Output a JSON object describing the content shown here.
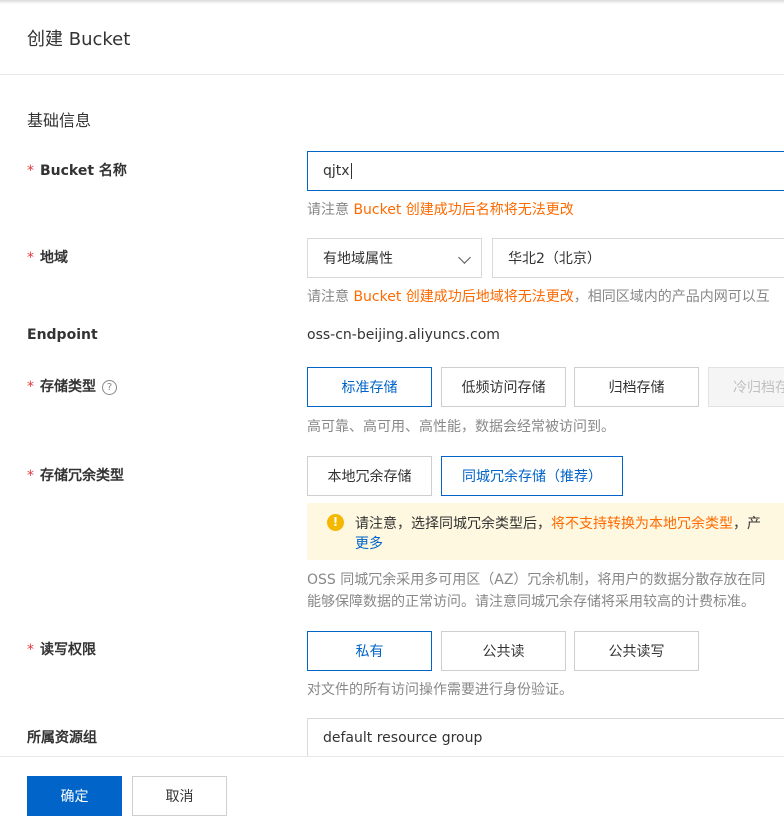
{
  "dialog": {
    "title": "创建 Bucket"
  },
  "basic": {
    "section_title": "基础信息"
  },
  "bucket_name": {
    "required_mark": "*",
    "label": "Bucket 名称",
    "value": "qjtx",
    "hint_prefix": "请注意 ",
    "hint_warn": "Bucket 创建成功后名称将无法更改"
  },
  "region": {
    "required_mark": "*",
    "label": "地域",
    "attr_select": "有地域属性",
    "region_select": "华北2（北京）",
    "hint_prefix": "请注意 ",
    "hint_warn": "Bucket 创建成功后地域将无法更改",
    "hint_suffix": "，相同区域内的产品内网可以互"
  },
  "endpoint": {
    "label": "Endpoint",
    "value": "oss-cn-beijing.aliyuncs.com"
  },
  "storage_class": {
    "required_mark": "*",
    "label": "存储类型",
    "help": "?",
    "options": [
      "标准存储",
      "低频访问存储",
      "归档存储",
      "冷归档存"
    ],
    "selected": "标准存储",
    "description": "高可靠、高可用、高性能，数据会经常被访问到。"
  },
  "redundancy": {
    "required_mark": "*",
    "label": "存储冗余类型",
    "options": [
      "本地冗余存储",
      "同城冗余存储（推荐）"
    ],
    "selected": "同城冗余存储（推荐）",
    "notice_icon": "!",
    "notice_prefix": "请注意，选择同城冗余类型后，",
    "notice_warn": "将不支持转换为本地冗余类型",
    "notice_suffix": "，产",
    "notice_more": "更多",
    "desc_line1": "OSS 同城冗余采用多可用区（AZ）冗余机制，将用户的数据分散存放在同",
    "desc_line2": "能够保障数据的正常访问。请注意同城冗余存储将采用较高的计费标准。"
  },
  "acl": {
    "required_mark": "*",
    "label": "读写权限",
    "options": [
      "私有",
      "公共读",
      "公共读写"
    ],
    "selected": "私有",
    "description": "对文件的所有访问操作需要进行身份验证。"
  },
  "resource_group": {
    "label": "所属资源组",
    "value": "default resource group"
  },
  "footer": {
    "confirm": "确定",
    "cancel": "取消"
  },
  "colors": {
    "primary": "#0064c8",
    "warning_text": "#ff6a00",
    "required": "#e4393c",
    "notice_bg": "#fff8e1"
  }
}
